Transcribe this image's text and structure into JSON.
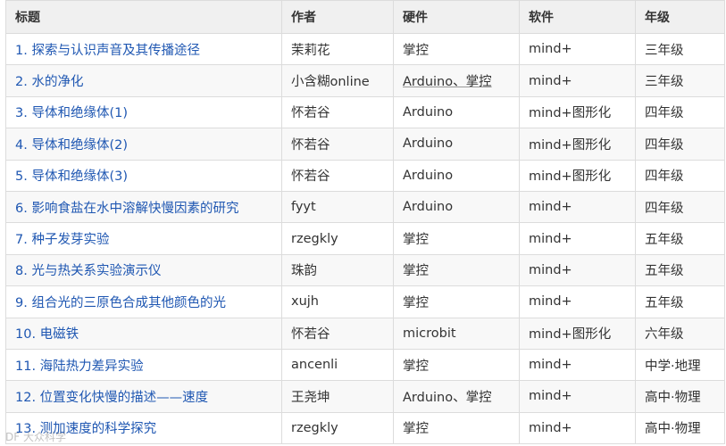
{
  "table": {
    "columns": [
      "标题",
      "作者",
      "硬件",
      "软件",
      "年级"
    ],
    "rows": [
      {
        "title": "1. 探索与认识声音及其传播途径",
        "author": "茉莉花",
        "hardware": "掌控",
        "software": "mind+",
        "grade": "三年级"
      },
      {
        "title": "2. 水的净化",
        "author": "小含糊online",
        "hardware": "Arduino、掌控",
        "software": "mind+",
        "grade": "三年级"
      },
      {
        "title": "3. 导体和绝缘体(1)",
        "author": "怀若谷",
        "hardware": "Arduino",
        "software": "mind+图形化",
        "grade": "四年级"
      },
      {
        "title": "4. 导体和绝缘体(2)",
        "author": "怀若谷",
        "hardware": "Arduino",
        "software": "mind+图形化",
        "grade": "四年级"
      },
      {
        "title": "5. 导体和绝缘体(3)",
        "author": "怀若谷",
        "hardware": "Arduino",
        "software": "mind+图形化",
        "grade": "四年级"
      },
      {
        "title": "6. 影响食盐在水中溶解快慢因素的研究",
        "author": "fyyt",
        "hardware": "Arduino",
        "software": "mind+",
        "grade": "四年级"
      },
      {
        "title": "7. 种子发芽实验",
        "author": "rzegkly",
        "hardware": "掌控",
        "software": "mind+",
        "grade": "五年级"
      },
      {
        "title": "8. 光与热关系实验演示仪",
        "author": "珠韵",
        "hardware": "掌控",
        "software": "mind+",
        "grade": "五年级"
      },
      {
        "title": "9. 组合光的三原色合成其他颜色的光",
        "author": "xujh",
        "hardware": "掌控",
        "software": "mind+",
        "grade": "五年级"
      },
      {
        "title": "10. 电磁铁",
        "author": "怀若谷",
        "hardware": "microbit",
        "software": "mind+图形化",
        "grade": "六年级"
      },
      {
        "title": "11. 海陆热力差异实验",
        "author": "ancenli",
        "hardware": "掌控",
        "software": "mind+",
        "grade": "中学·地理"
      },
      {
        "title": "12. 位置变化快慢的描述——速度",
        "author": "王尧坤",
        "hardware": "Arduino、掌控",
        "software": "mind+",
        "grade": "高中·物理"
      },
      {
        "title": "13. 测加速度的科学探究",
        "author": "rzegkly",
        "hardware": "掌控",
        "software": "mind+",
        "grade": "高中·物理"
      }
    ]
  },
  "watermark": "DF 大众科学"
}
